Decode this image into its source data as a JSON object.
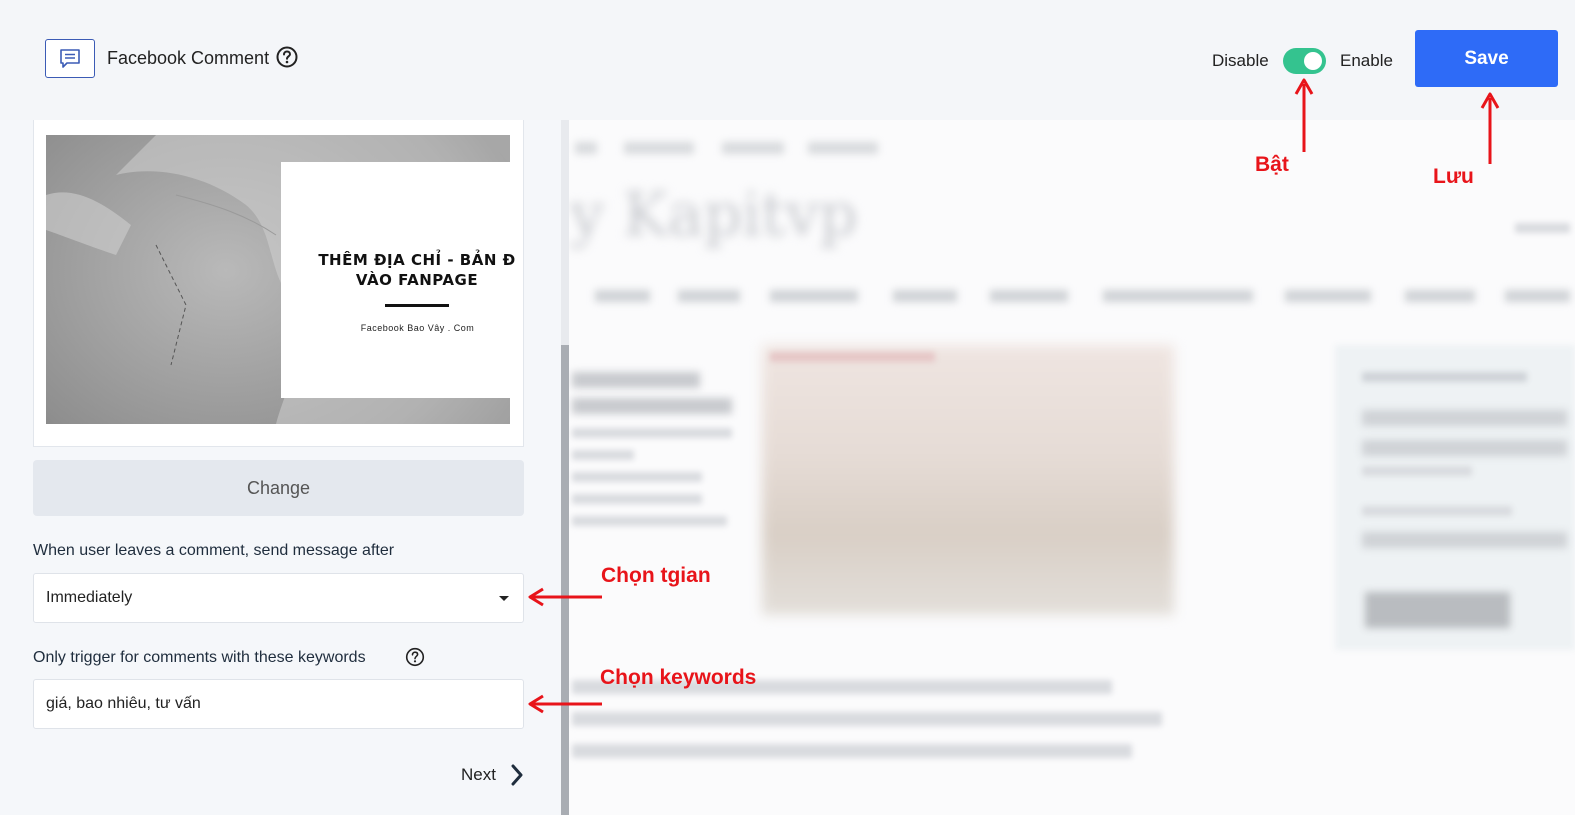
{
  "header": {
    "title": "Facebook Comment",
    "disable_label": "Disable",
    "enable_label": "Enable",
    "toggle_state": "enabled",
    "save_label": "Save"
  },
  "image_card": {
    "heading": "THÊM ĐỊA CHỈ - BẢN Đ\nVÀO FANPAGE",
    "subtext": "Facebook Bao Vây . Com"
  },
  "change_label": "Change",
  "delay_field": {
    "label": "When user leaves a comment, send message after",
    "value": "Immediately"
  },
  "keywords_field": {
    "label": "Only trigger for comments with these keywords",
    "value": "giá, bao nhiêu, tư vấn"
  },
  "next_label": "Next",
  "annotations": {
    "toggle_note": "Bật",
    "save_note": "Lưu",
    "delay_note": "Chọn tgian",
    "keywords_note": "Chọn keywords"
  },
  "colors": {
    "accent": "#2e6bf7",
    "toggle_on": "#34c38f",
    "annotation": "#e8141a"
  },
  "icons": [
    "comment-icon",
    "help-circle-icon",
    "caret-down-icon",
    "chevron-right-icon",
    "arrow-icon"
  ]
}
